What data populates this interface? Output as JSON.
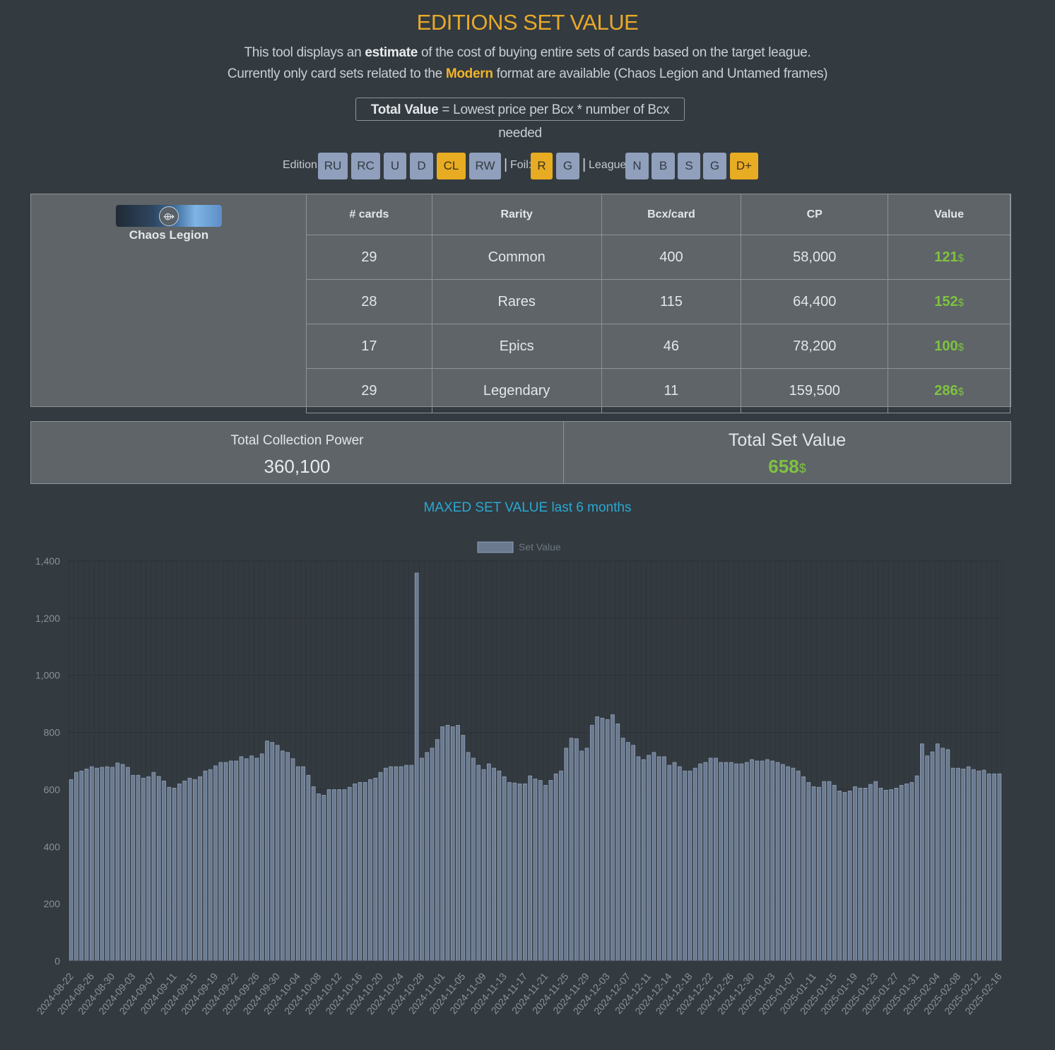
{
  "page": {
    "title": "EDITIONS SET VALUE",
    "desc1_pre": "This tool displays an ",
    "desc1_bold": "estimate",
    "desc1_post": " of the cost of buying entire sets of cards based on the target league.",
    "desc2_pre": "Currently only card sets related to the ",
    "desc2_bold": "Modern",
    "desc2_post": " format are available (Chaos Legion and Untamed frames)",
    "formula_bold": "Total Value",
    "formula_rest": " = Lowest price per Bcx * number of Bcx needed"
  },
  "filters": {
    "edition_label": "Edition:",
    "foil_label": "Foil:",
    "league_label": "League:",
    "separator": "|",
    "editions": [
      {
        "label": "RU",
        "active": false
      },
      {
        "label": "RC",
        "active": false
      },
      {
        "label": "U",
        "active": false
      },
      {
        "label": "D",
        "active": false
      },
      {
        "label": "CL",
        "active": true
      },
      {
        "label": "RW",
        "active": false
      }
    ],
    "foils": [
      {
        "label": "R",
        "active": true
      },
      {
        "label": "G",
        "active": false
      }
    ],
    "leagues": [
      {
        "label": "N",
        "active": false
      },
      {
        "label": "B",
        "active": false
      },
      {
        "label": "S",
        "active": false
      },
      {
        "label": "G",
        "active": false
      },
      {
        "label": "D+",
        "active": true
      }
    ],
    "active_color": "#e8ac22",
    "inactive_color": "#8f9fbc"
  },
  "edition": {
    "name": "Chaos Legion",
    "icon": "chaos-legion-emblem-icon"
  },
  "table": {
    "headers": [
      "# cards",
      "Rarity",
      "Bcx/card",
      "CP",
      "Value"
    ],
    "rows": [
      {
        "cards": "29",
        "rarity": "Common",
        "bcx": "400",
        "cp": "58,000",
        "value": "121",
        "unit": "$"
      },
      {
        "cards": "28",
        "rarity": "Rares",
        "bcx": "115",
        "cp": "64,400",
        "value": "152",
        "unit": "$"
      },
      {
        "cards": "17",
        "rarity": "Epics",
        "bcx": "46",
        "cp": "78,200",
        "value": "100",
        "unit": "$"
      },
      {
        "cards": "29",
        "rarity": "Legendary",
        "bcx": "11",
        "cp": "159,500",
        "value": "286",
        "unit": "$"
      }
    ]
  },
  "totals": {
    "cp_label": "Total Collection Power",
    "cp_value": "360,100",
    "value_label": "Total Set Value",
    "value_value": "658",
    "value_unit": "$"
  },
  "chart_title": "MAXED SET VALUE last 6 months",
  "chart_data": {
    "type": "bar",
    "legend": [
      "Set Value"
    ],
    "legend_position": "top",
    "ylim": [
      0,
      1400
    ],
    "yticks": [
      0,
      200,
      400,
      600,
      800,
      1000,
      1200,
      1400
    ],
    "grid": true,
    "bar_color": "#6b7a8f",
    "bar_border": "#8fa0b8",
    "xlabels": [
      "2024-08-22",
      "2024-08-26",
      "2024-08-30",
      "2024-09-03",
      "2024-09-07",
      "2024-09-11",
      "2024-09-15",
      "2024-09-19",
      "2024-09-22",
      "2024-09-26",
      "2024-09-30",
      "2024-10-04",
      "2024-10-08",
      "2024-10-12",
      "2024-10-16",
      "2024-10-20",
      "2024-10-24",
      "2024-10-28",
      "2024-11-01",
      "2024-11-05",
      "2024-11-09",
      "2024-11-13",
      "2024-11-17",
      "2024-11-21",
      "2024-11-25",
      "2024-11-29",
      "2024-12-03",
      "2024-12-07",
      "2024-12-11",
      "2024-12-14",
      "2024-12-18",
      "2024-12-22",
      "2024-12-26",
      "2024-12-30",
      "2025-01-03",
      "2025-01-07",
      "2025-01-11",
      "2025-01-15",
      "2025-01-19",
      "2025-01-23",
      "2025-01-27",
      "2025-01-31",
      "2025-02-04",
      "2025-02-08",
      "2025-02-12",
      "2025-02-16"
    ],
    "label_every": 4,
    "series": [
      {
        "name": "Set Value",
        "values": [
          635,
          660,
          665,
          672,
          680,
          675,
          678,
          680,
          678,
          693,
          688,
          678,
          650,
          650,
          640,
          645,
          660,
          646,
          630,
          608,
          605,
          620,
          630,
          640,
          635,
          645,
          665,
          670,
          683,
          695,
          695,
          700,
          700,
          715,
          708,
          718,
          710,
          725,
          770,
          765,
          755,
          735,
          730,
          708,
          680,
          680,
          650,
          610,
          585,
          580,
          600,
          600,
          600,
          600,
          608,
          620,
          625,
          625,
          635,
          640,
          660,
          675,
          680,
          680,
          680,
          685,
          685,
          1358,
          710,
          730,
          745,
          775,
          820,
          825,
          820,
          825,
          790,
          730,
          710,
          685,
          670,
          690,
          675,
          665,
          645,
          625,
          623,
          620,
          620,
          648,
          637,
          632,
          615,
          632,
          655,
          665,
          745,
          780,
          778,
          735,
          745,
          825,
          855,
          850,
          845,
          862,
          830,
          780,
          765,
          755,
          715,
          705,
          720,
          730,
          715,
          715,
          685,
          695,
          680,
          665,
          665,
          675,
          690,
          695,
          710,
          710,
          695,
          695,
          695,
          690,
          690,
          695,
          705,
          700,
          700,
          705,
          700,
          695,
          688,
          680,
          675,
          665,
          645,
          625,
          610,
          608,
          628,
          628,
          615,
          595,
          590,
          595,
          610,
          605,
          605,
          618,
          628,
          605,
          598,
          600,
          605,
          615,
          620,
          625,
          648,
          760,
          718,
          732,
          760,
          745,
          740,
          675,
          675,
          672,
          680,
          670,
          665,
          668,
          655,
          655,
          655
        ]
      }
    ]
  }
}
